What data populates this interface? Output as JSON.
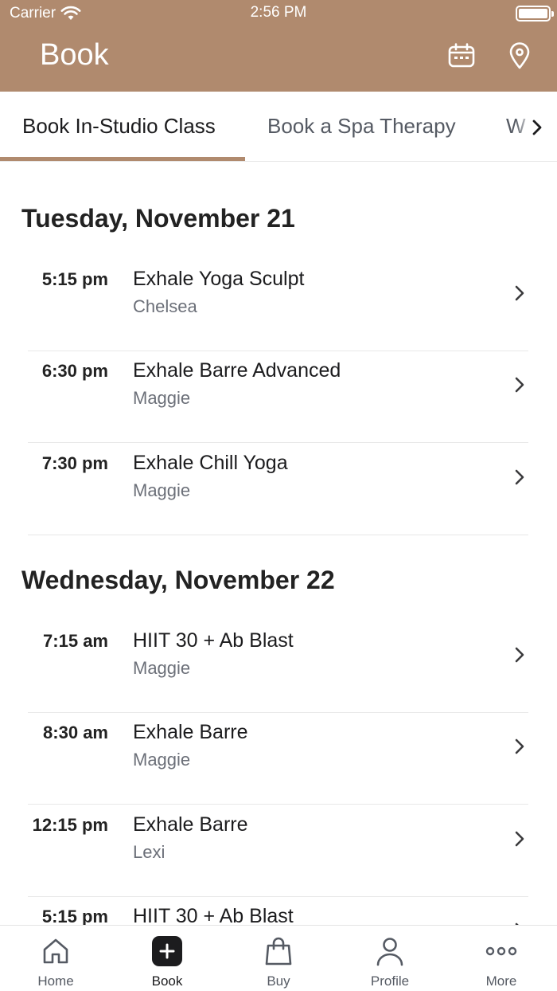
{
  "status_bar": {
    "carrier": "Carrier",
    "time": "2:56 PM"
  },
  "header": {
    "title": "Book"
  },
  "tabs": [
    {
      "label": "Book In-Studio Class",
      "active": true
    },
    {
      "label": "Book a Spa Therapy",
      "active": false
    },
    {
      "label": "W",
      "active": false
    }
  ],
  "days": [
    {
      "title": "Tuesday, November 21",
      "classes": [
        {
          "time": "5:15 pm",
          "name": "Exhale Yoga Sculpt",
          "instructor": "Chelsea"
        },
        {
          "time": "6:30 pm",
          "name": "Exhale Barre Advanced",
          "instructor": "Maggie"
        },
        {
          "time": "7:30 pm",
          "name": "Exhale Chill Yoga",
          "instructor": "Maggie"
        }
      ]
    },
    {
      "title": "Wednesday, November 22",
      "classes": [
        {
          "time": "7:15 am",
          "name": "HIIT 30 + Ab Blast",
          "instructor": "Maggie"
        },
        {
          "time": "8:30 am",
          "name": "Exhale Barre",
          "instructor": "Maggie"
        },
        {
          "time": "12:15 pm",
          "name": "Exhale Barre",
          "instructor": "Lexi"
        },
        {
          "time": "5:15 pm",
          "name": "HIIT 30 + Ab Blast",
          "instructor": ""
        }
      ]
    }
  ],
  "tab_bar": [
    {
      "label": "Home",
      "icon": "home-icon"
    },
    {
      "label": "Book",
      "icon": "plus-icon",
      "active": true
    },
    {
      "label": "Buy",
      "icon": "shopping-bag-icon"
    },
    {
      "label": "Profile",
      "icon": "person-icon"
    },
    {
      "label": "More",
      "icon": "more-dots-icon"
    }
  ],
  "colors": {
    "brand": "#b08a6e",
    "text": "#1c1c1e",
    "secondary_text": "#6b6f78"
  }
}
